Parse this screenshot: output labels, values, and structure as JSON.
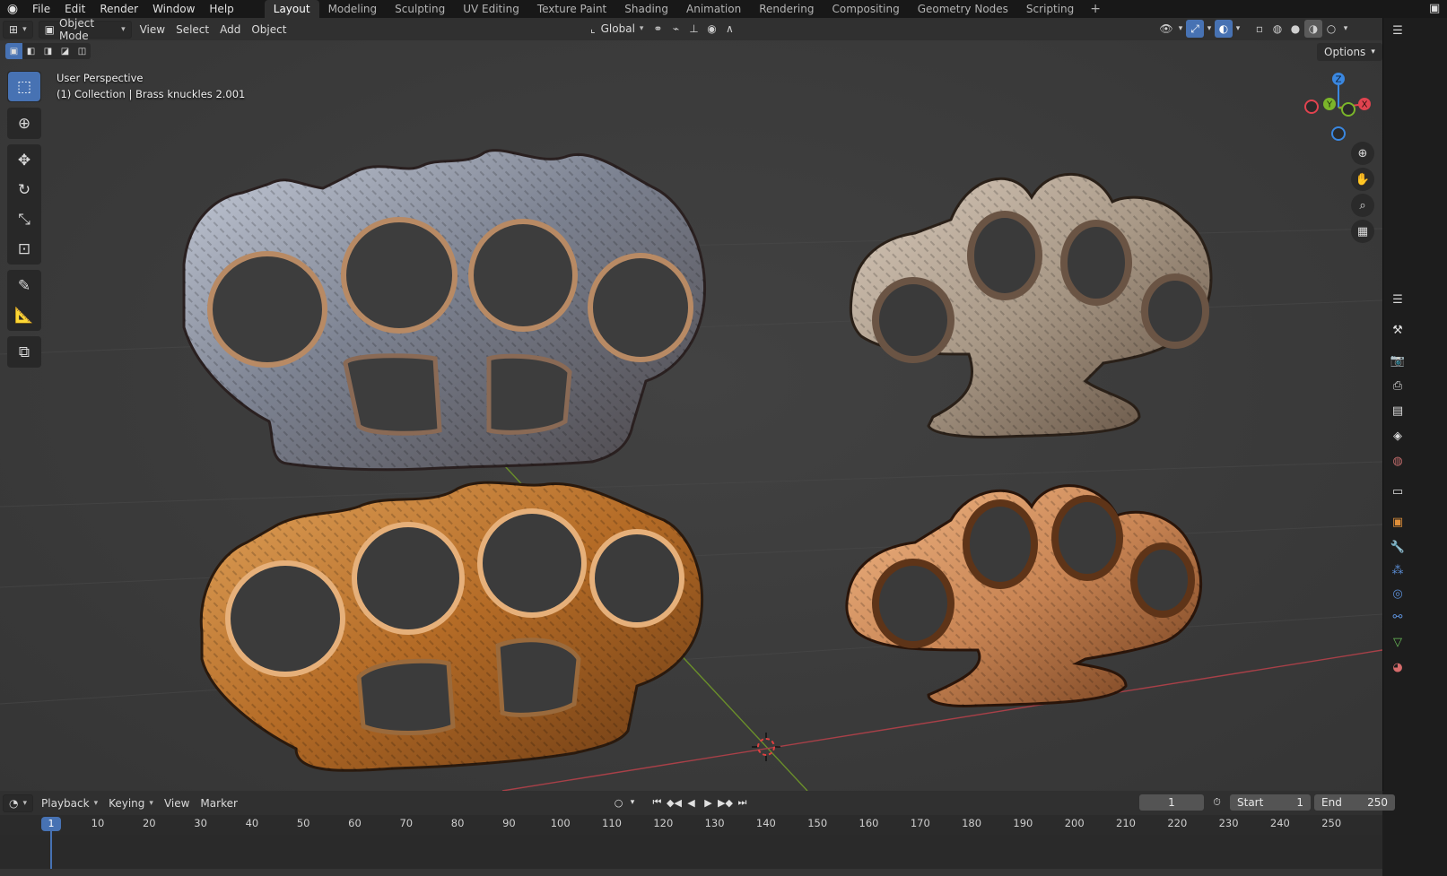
{
  "topbar": {
    "menus": [
      "File",
      "Edit",
      "Render",
      "Window",
      "Help"
    ],
    "workspaces": [
      "Layout",
      "Modeling",
      "Sculpting",
      "UV Editing",
      "Texture Paint",
      "Shading",
      "Animation",
      "Rendering",
      "Compositing",
      "Geometry Nodes",
      "Scripting"
    ],
    "active_workspace": "Layout",
    "add_tab": "+"
  },
  "header": {
    "mode": "Object Mode",
    "menus": [
      "View",
      "Select",
      "Add",
      "Object"
    ],
    "orientation": "Global"
  },
  "subheader": {
    "options_label": "Options"
  },
  "viewport": {
    "perspective_label": "User Perspective",
    "collection_label": "(1) Collection | Brass knuckles 2.001"
  },
  "gizmo": {
    "x": "X",
    "y": "Y",
    "z": "Z"
  },
  "timeline": {
    "menus": [
      "Playback",
      "Keying",
      "View",
      "Marker"
    ],
    "current_frame": "1",
    "start_label": "Start",
    "start_value": "1",
    "end_label": "End",
    "end_value": "250",
    "ruler_labels": [
      "10",
      "20",
      "30",
      "40",
      "50",
      "60",
      "70",
      "80",
      "90",
      "100",
      "110",
      "120",
      "130",
      "140",
      "150",
      "160",
      "170",
      "180",
      "190",
      "200",
      "210",
      "220",
      "230",
      "240",
      "250"
    ],
    "ruler_current": "1"
  },
  "colors": {
    "accent": "#4772b3",
    "axis_x": "#e0434f",
    "axis_y": "#7bb52a",
    "axis_z": "#3a87e0"
  }
}
